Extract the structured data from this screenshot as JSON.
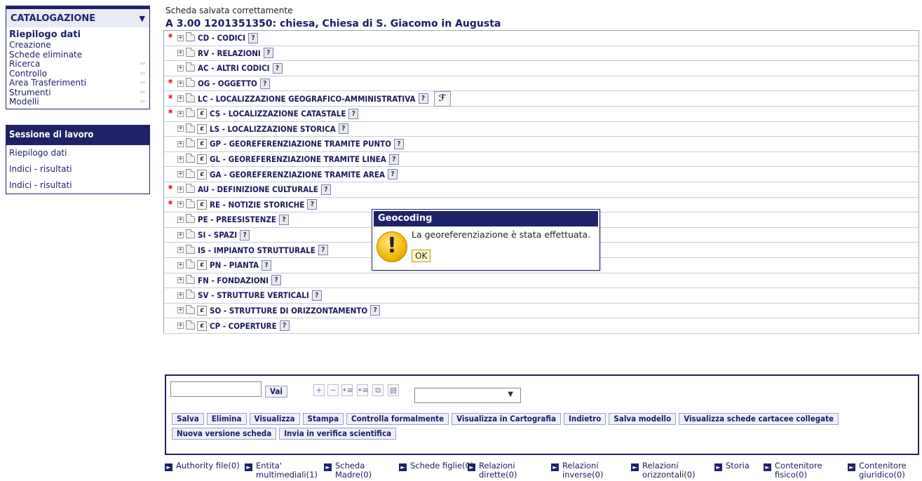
{
  "sidebar": {
    "header": "CATALOGAZIONE",
    "items": [
      {
        "label": "Riepilogo dati",
        "arrow": "",
        "active": true
      },
      {
        "label": "Creazione",
        "arrow": ""
      },
      {
        "label": "Schede eliminate",
        "arrow": ""
      },
      {
        "label": "Ricerca",
        "arrow": "››"
      },
      {
        "label": "Controllo",
        "arrow": "››"
      },
      {
        "label": "Area Trasferimenti",
        "arrow": "››"
      },
      {
        "label": "Strumenti",
        "arrow": "››"
      },
      {
        "label": "Modelli",
        "arrow": "››"
      }
    ],
    "session_header": "Sessione di lavoro",
    "session_items": [
      "Riepilogo dati",
      "Indici - risultati",
      "Indici - risultati"
    ]
  },
  "main": {
    "saved_message": "Scheda salvata correttamente",
    "record_title": "A 3.00 1201351350: chiesa, Chiesa di S. Giacomo in Augusta",
    "sections": [
      {
        "label": "CD - CODICI",
        "required": true,
        "refresh": false
      },
      {
        "label": "RV - RELAZIONI",
        "required": false,
        "refresh": false
      },
      {
        "label": "AC - ALTRI CODICI",
        "required": false,
        "refresh": false
      },
      {
        "label": "OG - OGGETTO",
        "required": true,
        "refresh": false
      },
      {
        "label": "LC - LOCALIZZAZIONE GEOGRAFICO-AMMINISTRATIVA",
        "required": true,
        "refresh": false,
        "map_tool": true
      },
      {
        "label": "CS - LOCALIZZAZIONE CATASTALE",
        "required": true,
        "refresh": true
      },
      {
        "label": "LS - LOCALIZZAZIONE STORICA",
        "required": false,
        "refresh": true
      },
      {
        "label": "GP - GEOREFERENZIAZIONE TRAMITE PUNTO",
        "required": false,
        "refresh": true
      },
      {
        "label": "GL - GEOREFERENZIAZIONE TRAMITE LINEA",
        "required": false,
        "refresh": true
      },
      {
        "label": "GA - GEOREFERENZIAZIONE TRAMITE AREA",
        "required": false,
        "refresh": true
      },
      {
        "label": "AU - DEFINIZIONE CULTURALE",
        "required": true,
        "refresh": false
      },
      {
        "label": "RE - NOTIZIE STORICHE",
        "required": true,
        "refresh": true
      },
      {
        "label": "PE - PREESISTENZE",
        "required": false,
        "refresh": false
      },
      {
        "label": "SI - SPAZI",
        "required": false,
        "refresh": false
      },
      {
        "label": "IS - IMPIANTO STRUTTURALE",
        "required": false,
        "refresh": false
      },
      {
        "label": "PN - PIANTA",
        "required": false,
        "refresh": true
      },
      {
        "label": "FN - FONDAZIONI",
        "required": false,
        "refresh": false
      },
      {
        "label": "SV - STRUTTURE VERTICALI",
        "required": false,
        "refresh": false
      },
      {
        "label": "SO - STRUTTURE DI ORIZZONTAMENTO",
        "required": false,
        "refresh": true
      },
      {
        "label": "CP - COPERTURE",
        "required": false,
        "refresh": true
      }
    ],
    "required_mark": "*",
    "expand_glyph": "+",
    "refresh_glyph": "ȼ",
    "help_glyph": "?",
    "map_tool_glyph": "ℱ"
  },
  "dialog": {
    "title": "Geocoding",
    "message": "La georeferenziazione è stata effettuata.",
    "ok_label": "OK",
    "icon_glyph": "!"
  },
  "toolbar": {
    "input_value": "",
    "vai_label": "Vai",
    "icons": [
      "plus-icon",
      "minus-icon",
      "list-red-icon",
      "list-green-icon",
      "copy-icon",
      "window-icon"
    ],
    "icon_glyphs": [
      "+",
      "−",
      "•≡",
      "•≡",
      "⧉",
      "▤"
    ],
    "select_value": "",
    "buttons_row1": [
      "Salva",
      "Elimina",
      "Visualizza",
      "Stampa",
      "Controlla formalmente",
      "Visualizza in Cartografia",
      "Indietro",
      "Salva modello",
      "Visualizza schede cartacee collegate"
    ],
    "buttons_row2": [
      "Nuova versione scheda",
      "Invia in verifica scientifica"
    ]
  },
  "links": [
    {
      "label": "Authority file(0)"
    },
    {
      "label": "Entita' multimediali(1)"
    },
    {
      "label": "Scheda Madre(0)"
    },
    {
      "label": "Schede figlie(0)"
    },
    {
      "label": "Relazioni dirette(0)"
    },
    {
      "label": "Relazioni inverse(0)"
    },
    {
      "label": "Relazioni orizzontali(0)"
    },
    {
      "label": "Storia"
    },
    {
      "label": "Contenitore fisico(0)"
    },
    {
      "label": "Contenitore giuridico(0)"
    }
  ],
  "colors": {
    "primary": "#1f2266",
    "required": "#e00000",
    "dialog_ok_bg": "#fff9cc"
  }
}
